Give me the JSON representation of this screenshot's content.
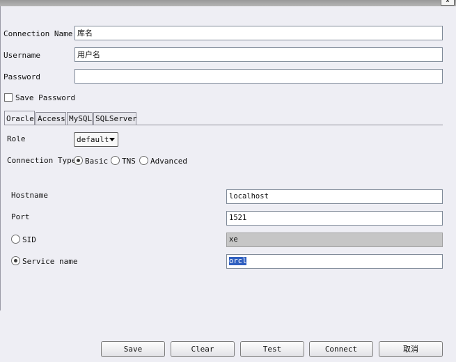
{
  "window": {
    "close_glyph": "×"
  },
  "form": {
    "connection_name": {
      "label": "Connection Name",
      "value": "库名"
    },
    "username": {
      "label": "Username",
      "value": "用户名"
    },
    "password": {
      "label": "Password",
      "value": ""
    },
    "save_password": {
      "label": "Save Password",
      "checked": false
    }
  },
  "tabs": [
    "Oracle",
    "Access",
    "MySQL",
    "SQLServer"
  ],
  "oracle": {
    "role_label": "Role",
    "role_value": "default",
    "connection_type_label": "Connection Type",
    "types": [
      "Basic",
      "TNS",
      "Advanced"
    ],
    "hostname": {
      "label": "Hostname",
      "value": "localhost"
    },
    "port": {
      "label": "Port",
      "value": "1521"
    },
    "sid": {
      "label": "SID",
      "value": "xe"
    },
    "service_name": {
      "label": "Service name",
      "value": "orcl"
    }
  },
  "buttons": {
    "save": "Save",
    "clear": "Clear",
    "test": "Test",
    "connect": "Connect",
    "cancel": "取消"
  }
}
